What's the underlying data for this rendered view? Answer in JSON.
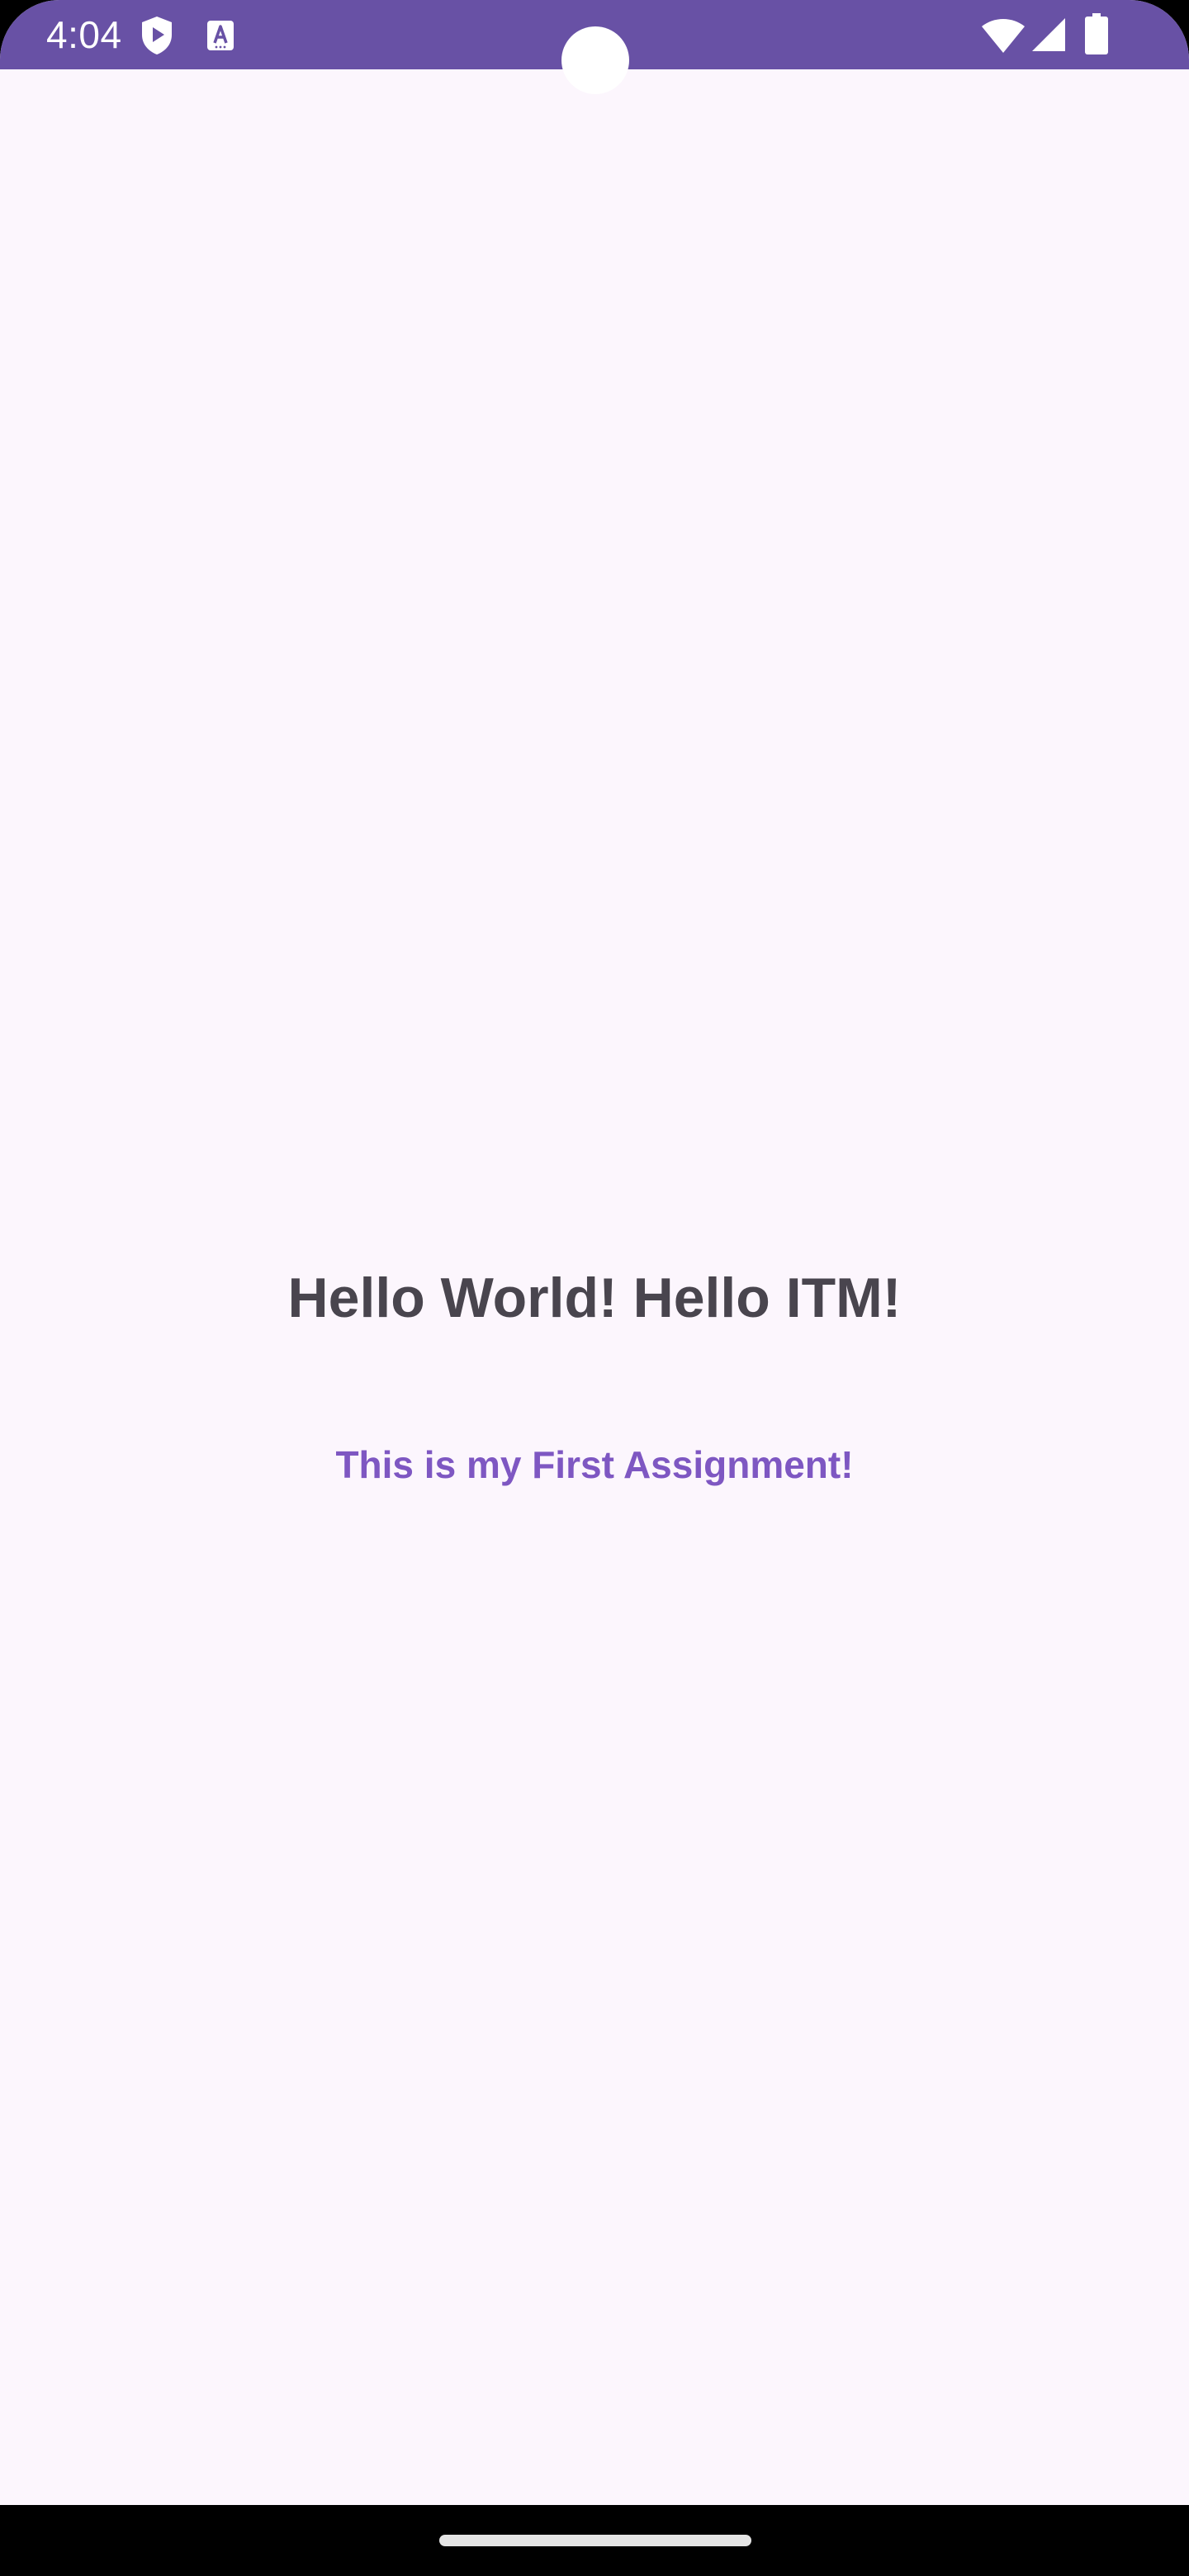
{
  "status_bar": {
    "time": "4:04",
    "icons": [
      "play-protect-shield-icon",
      "accessibility-a-icon",
      "wifi-icon",
      "cellular-signal-icon",
      "battery-icon"
    ],
    "background_color": "#6851a5"
  },
  "main": {
    "headline": "Hello World! Hello ITM!",
    "subtitle": "This is my First Assignment!",
    "background_color": "#fcf6fd",
    "headline_color": "#49454e",
    "subtitle_color": "#7e57c2"
  },
  "navigation": {
    "gesture_handle": "gesture-nav-handle"
  }
}
